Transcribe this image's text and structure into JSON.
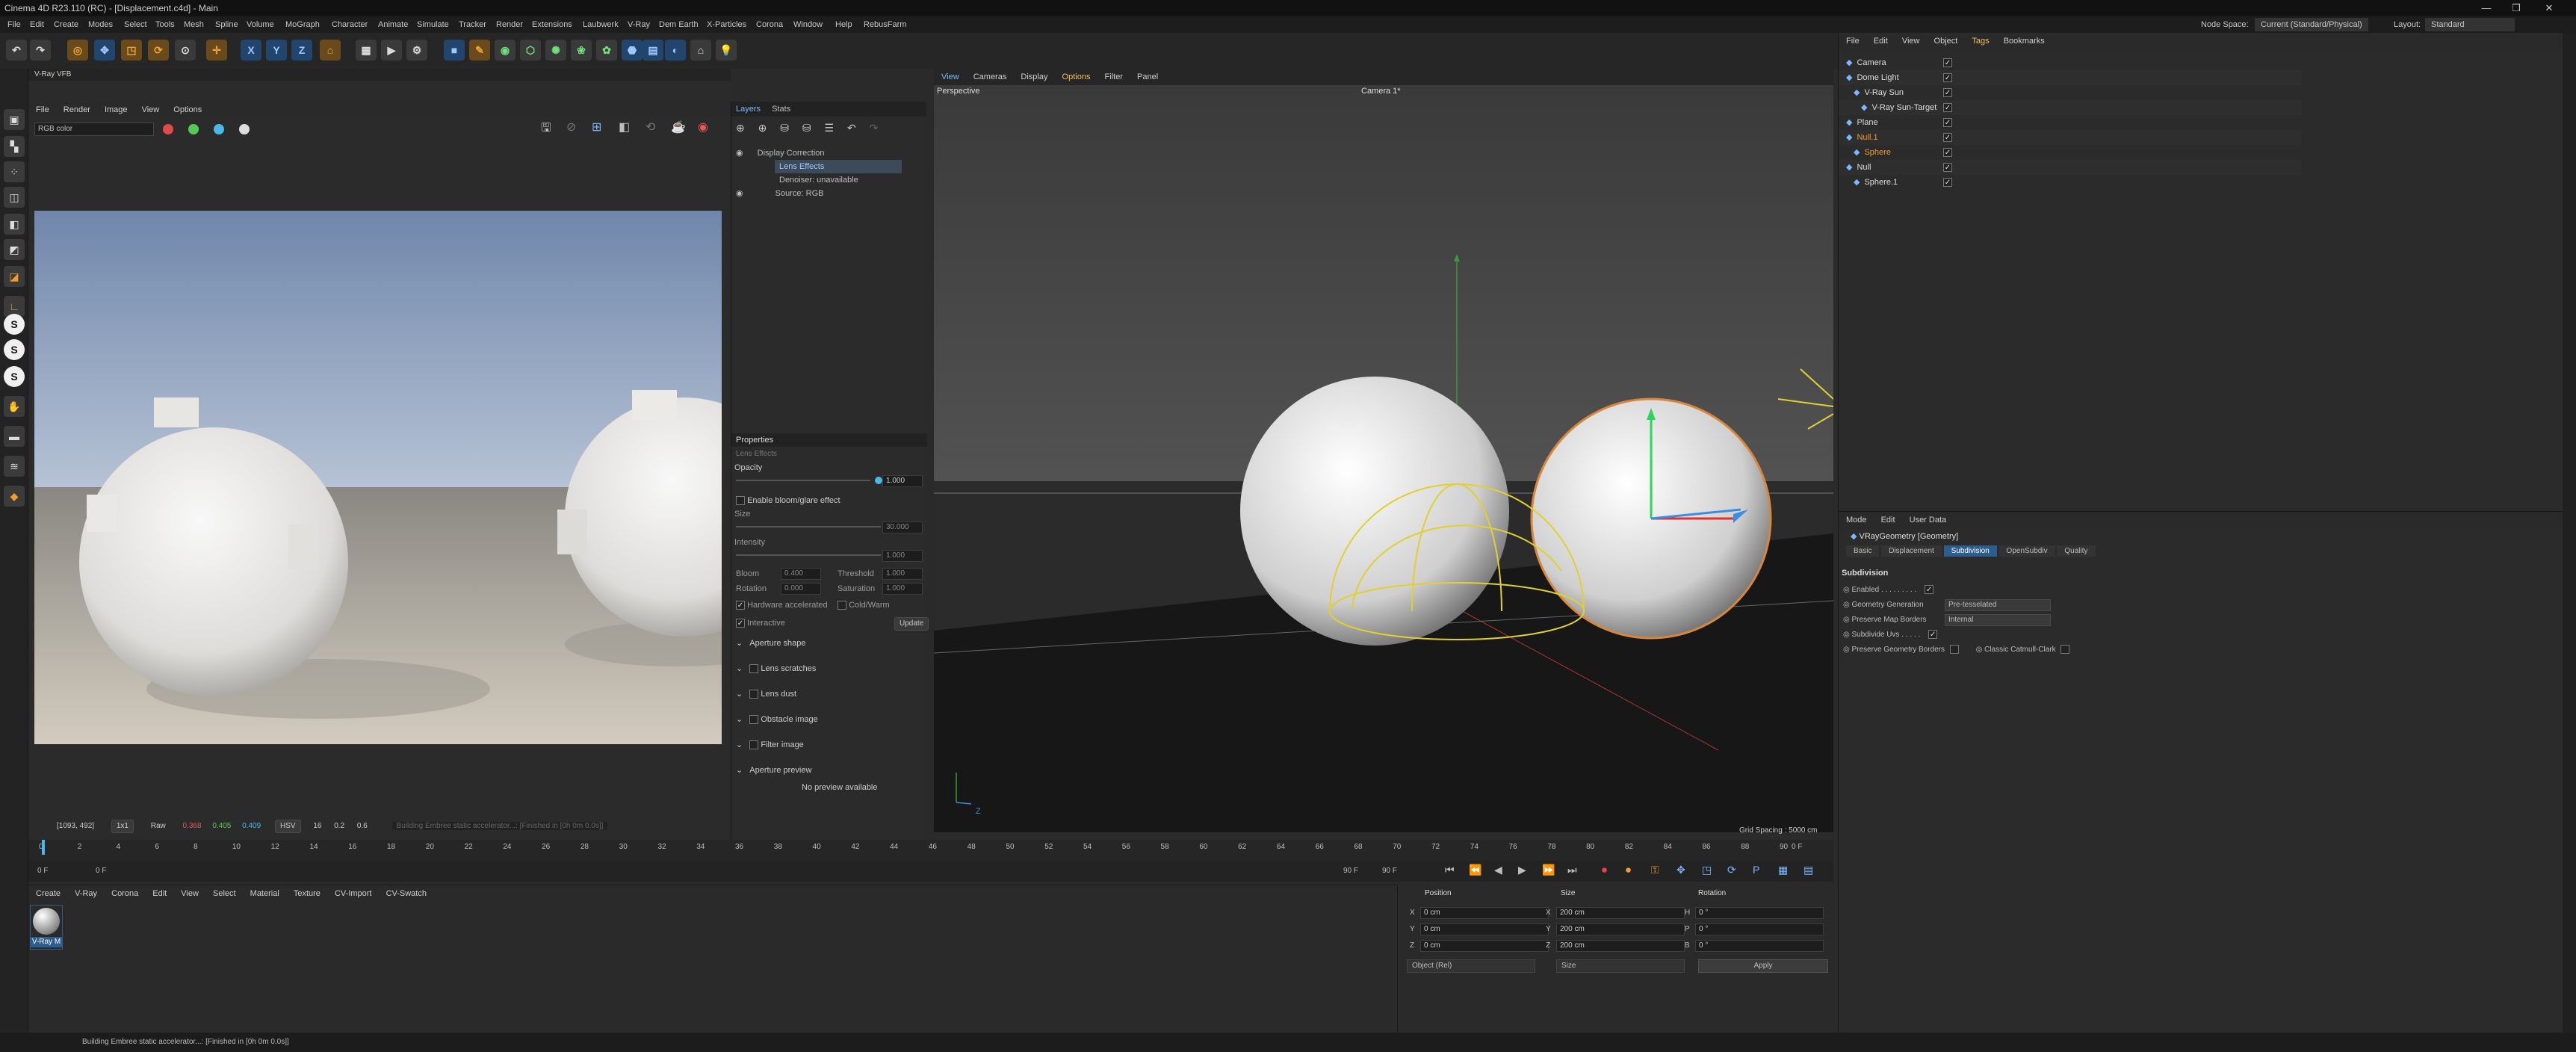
{
  "titlebar": {
    "title": "Cinema 4D R23.110 (RC) - [Displacement.c4d] - Main"
  },
  "menu": [
    "File",
    "Edit",
    "Create",
    "Modes",
    "Select",
    "Tools",
    "Mesh",
    "Spline",
    "Volume",
    "MoGraph",
    "Character",
    "Animate",
    "Simulate",
    "Tracker",
    "Render",
    "Extensions",
    "Laubwerk",
    "V-Ray",
    "Dem Earth",
    "X-Particles",
    "Corona",
    "Window",
    "Help",
    "RebusFarm"
  ],
  "nodespace": {
    "label": "Node Space:",
    "value": "Current (Standard/Physical)",
    "layout_label": "Layout:",
    "layout_value": "Standard"
  },
  "toolbar": {
    "axes": [
      "X",
      "Y",
      "Z"
    ]
  },
  "vfb": {
    "title": "V-Ray VFB",
    "menu": [
      "File",
      "Render",
      "Image",
      "View",
      "Options"
    ],
    "channel": "RGB color",
    "status": {
      "coords": "[1093, 492]",
      "zoom": "1x1",
      "mode": "Raw",
      "r": "0.368",
      "g": "0.405",
      "b": "0.409",
      "space": "HSV",
      "v1": "16",
      "v2": "0.2",
      "v3": "0.6",
      "msg": "Building Embree static accelerator...: [Finished in [0h  0m  0.0s]]"
    }
  },
  "layers": {
    "tabs": [
      "Layers",
      "Stats"
    ],
    "items": [
      "Display Correction",
      "Lens Effects",
      "Denoiser: unavailable",
      "Source: RGB"
    ]
  },
  "props": {
    "title": "Properties",
    "sub": "Lens Effects",
    "opacity_label": "Opacity",
    "opacity": "1.000",
    "bloom_label": "Enable bloom/glare effect",
    "size_label": "Size",
    "size": "30.000",
    "intensity_label": "Intensity",
    "intensity": "1.000",
    "bloom": "Bloom",
    "bloom_v": "0.400",
    "threshold": "Threshold",
    "threshold_v": "1.000",
    "rotation": "Rotation",
    "rotation_v": "0.000",
    "saturation": "Saturation",
    "saturation_v": "1.000",
    "hw": "Hardware accelerated",
    "cold": "Cold/Warm",
    "interactive": "Interactive",
    "update": "Update",
    "sections": [
      "Aperture shape",
      "Lens scratches",
      "Lens dust",
      "Obstacle image",
      "Filter image",
      "Aperture preview"
    ],
    "preview": "No preview available"
  },
  "viewport": {
    "menu": [
      "View",
      "Cameras",
      "Display",
      "Options",
      "Filter",
      "Panel"
    ],
    "label": "Perspective",
    "camera": "Camera 1*",
    "grid": "Grid Spacing : 5000 cm",
    "axis": "Z"
  },
  "timeline": {
    "ticks": [
      "0",
      "2",
      "4",
      "6",
      "8",
      "10",
      "12",
      "14",
      "16",
      "18",
      "20",
      "22",
      "24",
      "26",
      "28",
      "30",
      "32",
      "34",
      "36",
      "38",
      "40",
      "42",
      "44",
      "46",
      "48",
      "50",
      "52",
      "54",
      "56",
      "58",
      "60",
      "62",
      "64",
      "66",
      "68",
      "70",
      "72",
      "74",
      "76",
      "78",
      "80",
      "82",
      "84",
      "86",
      "88",
      "90"
    ],
    "cur": "0 F",
    "start": "0 F",
    "start2": "0 F",
    "end": "90 F",
    "end2": "90 F"
  },
  "objects": {
    "menu": [
      "File",
      "Edit",
      "View",
      "Object",
      "Tags",
      "Bookmarks"
    ],
    "rows": [
      "Camera",
      "Dome Light",
      "V-Ray Sun",
      "V-Ray Sun-Target",
      "Plane",
      "Null.1",
      "Sphere",
      "Null",
      "Sphere.1"
    ]
  },
  "attr": {
    "menu": [
      "Mode",
      "Edit",
      "User Data"
    ],
    "title": "VRayGeometry [Geometry]",
    "tabs": [
      "Basic",
      "Displacement",
      "Subdivision",
      "OpenSubdiv",
      "Quality"
    ],
    "section": "Subdivision",
    "rows": [
      {
        "label": "Enabled . . . . . . . . ."
      },
      {
        "label": "Geometry Generation",
        "value": "Pre-tesselated"
      },
      {
        "label": "Preserve Map Borders",
        "value": "Internal"
      },
      {
        "label": "Subdivide Uvs . . . . ."
      },
      {
        "label": "Preserve Geometry Borders",
        "extra": "Classic Catmull-Clark"
      }
    ]
  },
  "material": {
    "menu": [
      "Create",
      "V-Ray",
      "Corona",
      "Edit",
      "View",
      "Select",
      "Material",
      "Texture",
      "CV-Import",
      "CV-Swatch"
    ],
    "name": "V-Ray M"
  },
  "coords": {
    "headers": [
      "Position",
      "Size",
      "Rotation"
    ],
    "rows": [
      [
        "X",
        "0 cm",
        "X",
        "200 cm",
        "H",
        "0 °"
      ],
      [
        "Y",
        "0 cm",
        "Y",
        "200 cm",
        "P",
        "0 °"
      ],
      [
        "Z",
        "0 cm",
        "Z",
        "200 cm",
        "B",
        "0 °"
      ]
    ],
    "mode1": "Object (Rel)",
    "mode2": "Size",
    "apply": "Apply"
  },
  "statusbar": "Building Embree static accelerator...: [Finished in [0h  0m  0.0s]]",
  "colors": {
    "accent": "#2d5d8f",
    "orange": "#f39b2e"
  }
}
